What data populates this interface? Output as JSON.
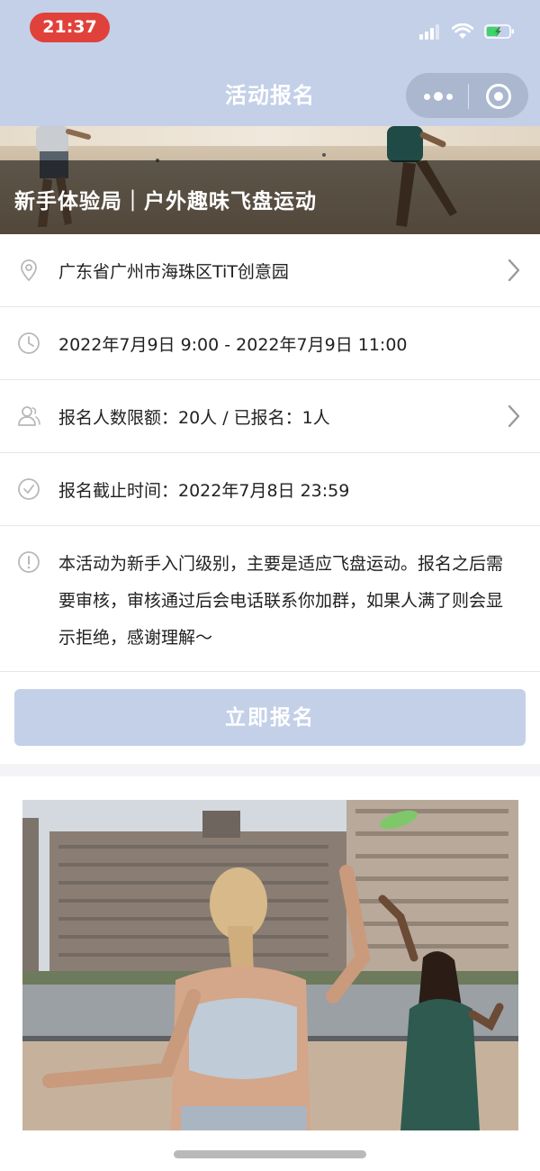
{
  "status_bar": {
    "time": "21:37"
  },
  "nav": {
    "title": "活动报名"
  },
  "banner": {
    "title": "新手体验局｜户外趣味飞盘运动"
  },
  "info": {
    "location": "广东省广州市海珠区TiT创意园",
    "time_range": "2022年7月9日 9:00 - 2022年7月9日 11:00",
    "quota": "报名人数限额：20人 / 已报名：1人",
    "deadline": "报名截止时间：2022年7月8日 23:59",
    "description": "本活动为新手入门级别，主要是适应飞盘运动。报名之后需要审核，审核通过后会电话联系你加群，如果人满了则会显示拒绝，感谢理解～"
  },
  "signup_button": {
    "label": "立即报名"
  },
  "icons": {
    "location": "location-pin-icon",
    "time": "clock-icon",
    "quota": "users-icon",
    "deadline": "check-circle-icon",
    "description": "info-icon",
    "chevron": "chevron-right-icon"
  },
  "colors": {
    "nav_bg": "#c3d0e8",
    "button_bg": "#c3d0e8",
    "time_pill": "#e0413a",
    "icon_gray": "#b8b8b8"
  }
}
